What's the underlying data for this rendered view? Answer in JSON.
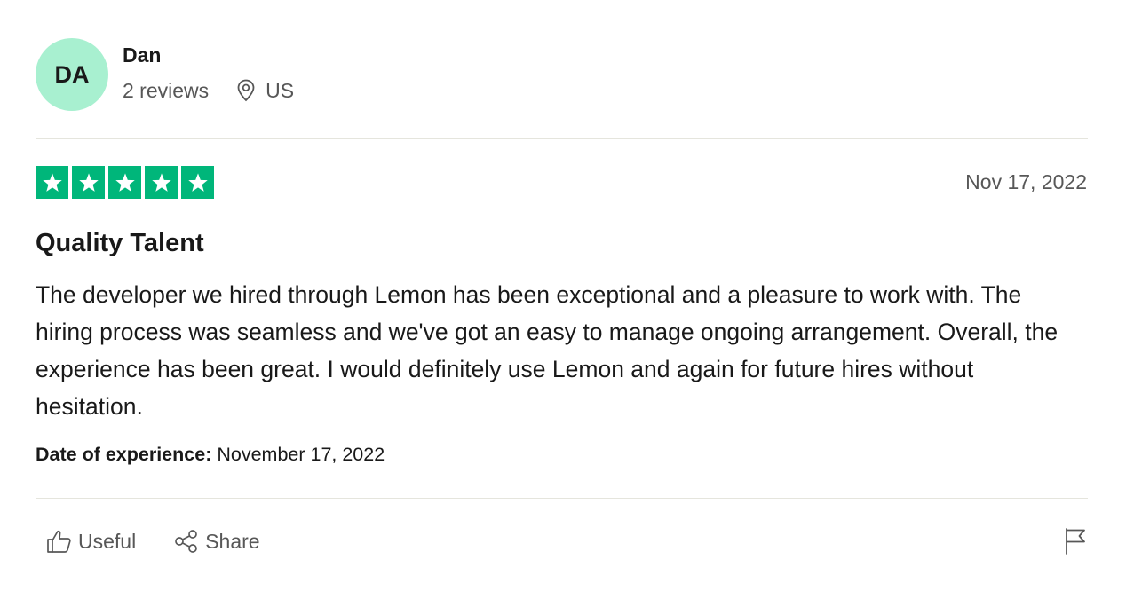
{
  "user": {
    "initials": "DA",
    "name": "Dan",
    "reviews_count": "2 reviews",
    "location": "US",
    "avatar_color": "#a8f0d0"
  },
  "review": {
    "rating": 5,
    "max_rating": 5,
    "star_color": "#00b67a",
    "date": "Nov 17, 2022",
    "title": "Quality Talent",
    "body": "The developer we hired through Lemon has been exceptional and a pleasure to work with. The hiring process was seamless and we've got an easy to manage ongoing arrangement. Overall, the experience has been great. I would definitely use Lemon and again for future hires without hesitation.",
    "experience_label": "Date of experience:",
    "experience_date": "November 17, 2022"
  },
  "actions": {
    "useful_label": "Useful",
    "share_label": "Share",
    "icons": [
      "thumbs-up-icon",
      "share-icon",
      "flag-icon"
    ]
  }
}
